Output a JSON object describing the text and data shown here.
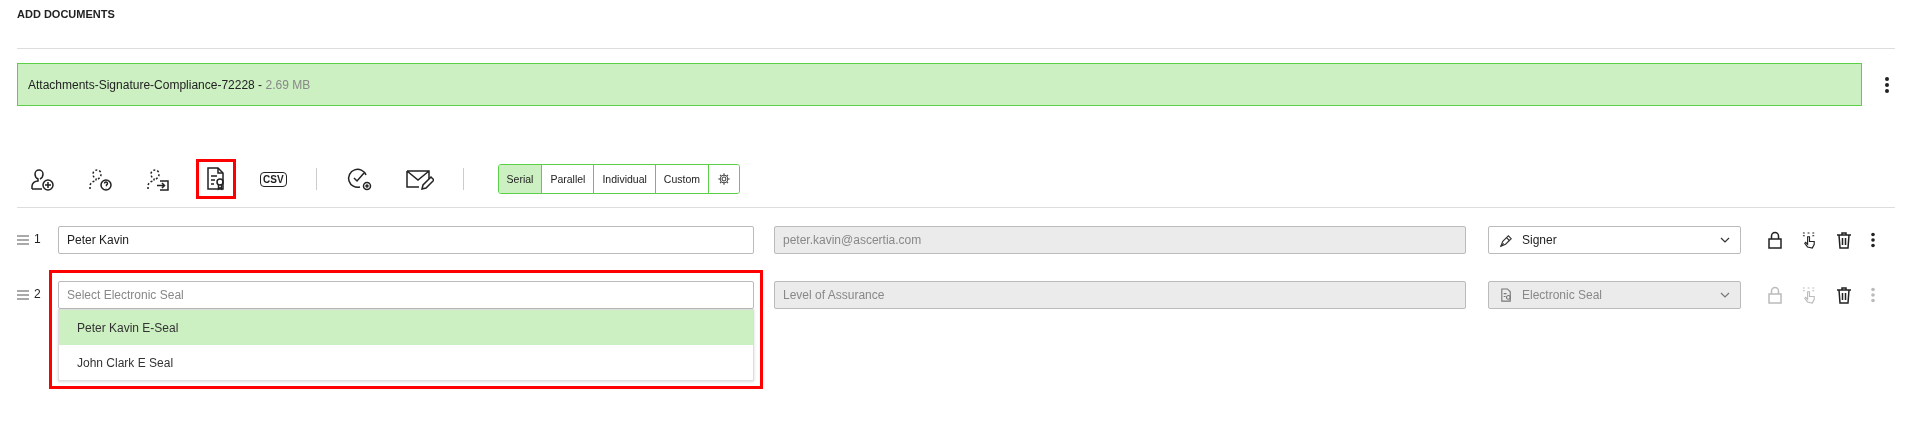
{
  "title": "ADD DOCUMENTS",
  "document": {
    "name": "Attachments-Signature-Compliance-72228",
    "separator": "-",
    "size": "2.69 MB"
  },
  "toolbar": {
    "groups": [
      [
        {
          "kind": "add-user",
          "highlighted": false
        },
        {
          "kind": "ask-user",
          "highlighted": false
        },
        {
          "kind": "move-user",
          "highlighted": false
        },
        {
          "kind": "seal-doc",
          "highlighted": true
        },
        {
          "kind": "csv",
          "label": "CSV",
          "highlighted": false
        }
      ],
      [
        {
          "kind": "check-settings",
          "highlighted": false
        },
        {
          "kind": "mail",
          "highlighted": false
        }
      ]
    ],
    "modes": [
      {
        "label": "Serial",
        "selected": true
      },
      {
        "label": "Parallel",
        "selected": false
      },
      {
        "label": "Individual",
        "selected": false
      },
      {
        "label": "Custom",
        "selected": false
      }
    ]
  },
  "rows": [
    {
      "number": "1",
      "name": {
        "value": "Peter Kavin",
        "highlighted": false
      },
      "email": {
        "value": "peter.kavin@ascertia.com",
        "disabled": true
      },
      "role": {
        "kind": "signer",
        "label": "Signer",
        "disabled": false
      },
      "actions": [
        {
          "kind": "lock",
          "disabled": false
        },
        {
          "kind": "hand",
          "disabled": false
        },
        {
          "kind": "trash",
          "disabled": false
        },
        {
          "kind": "more",
          "disabled": false
        }
      ]
    },
    {
      "number": "2",
      "name": {
        "placeholder": "Select Electronic Seal",
        "highlighted": true,
        "options": [
          {
            "label": "Peter Kavin E-Seal",
            "selected": true
          },
          {
            "label": "John Clark E Seal",
            "selected": false
          }
        ]
      },
      "email": {
        "placeholder": "Level of Assurance",
        "disabled": true
      },
      "role": {
        "kind": "seal",
        "label": "Electronic Seal",
        "disabled": true
      },
      "actions": [
        {
          "kind": "lock",
          "disabled": true
        },
        {
          "kind": "hand",
          "disabled": true
        },
        {
          "kind": "trash",
          "disabled": false
        },
        {
          "kind": "more",
          "disabled": true
        }
      ]
    }
  ]
}
